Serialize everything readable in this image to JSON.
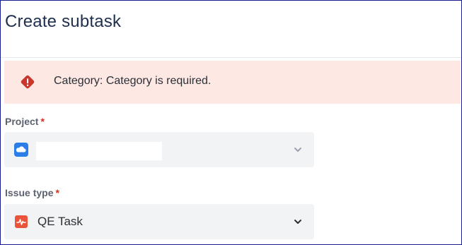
{
  "dialog": {
    "title": "Create subtask"
  },
  "error": {
    "message": "Category: Category is required."
  },
  "project": {
    "label": "Project",
    "required_mark": "*",
    "selected_value": ""
  },
  "issue_type": {
    "label": "Issue type",
    "required_mark": "*",
    "selected_value": "QE Task"
  },
  "icons": {
    "error": "error-diamond-icon",
    "project": "project-cloud-icon",
    "issue_type": "qe-task-icon",
    "dropdown": "chevron-down-icon"
  },
  "colors": {
    "title": "#1f2f4e",
    "error_bg": "#fde8e3",
    "error_icon": "#c9372c",
    "required": "#d7301f",
    "field_bg": "#f2f3f5",
    "project_icon": "#2b7de9",
    "qe_icon": "#e8533a"
  }
}
